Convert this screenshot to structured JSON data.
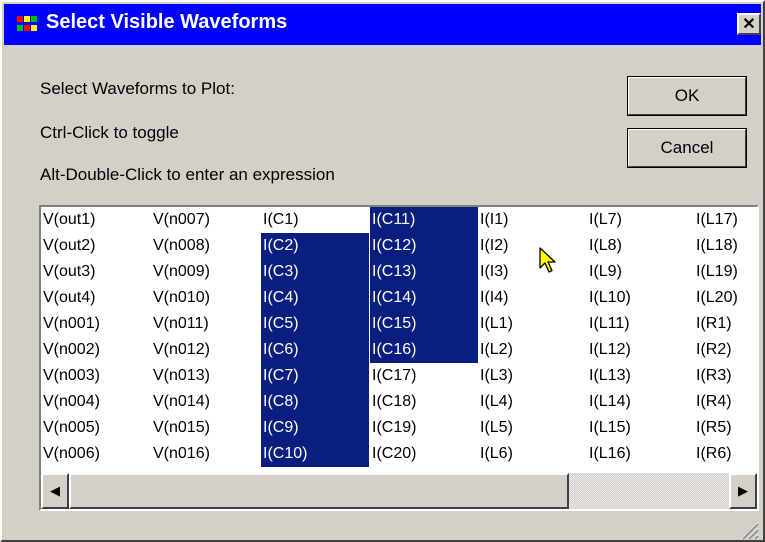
{
  "window": {
    "title": "Select Visible Waveforms",
    "close_label": "✕",
    "icon": "app-waveform-icon"
  },
  "instructions": {
    "line1": "Select Waveforms to Plot:",
    "line2": "Ctrl-Click to toggle",
    "line3": "Alt-Double-Click to enter an expression"
  },
  "buttons": {
    "ok": "OK",
    "cancel": "Cancel"
  },
  "colors": {
    "title_bar": "#0000ff",
    "selection": "#0a1e80",
    "face": "#d4d0c8"
  },
  "list": {
    "columns": [
      {
        "items": [
          {
            "label": "V(out1)",
            "selected": false
          },
          {
            "label": "V(out2)",
            "selected": false
          },
          {
            "label": "V(out3)",
            "selected": false
          },
          {
            "label": "V(out4)",
            "selected": false
          },
          {
            "label": "V(n001)",
            "selected": false
          },
          {
            "label": "V(n002)",
            "selected": false
          },
          {
            "label": "V(n003)",
            "selected": false
          },
          {
            "label": "V(n004)",
            "selected": false
          },
          {
            "label": "V(n005)",
            "selected": false
          },
          {
            "label": "V(n006)",
            "selected": false
          }
        ]
      },
      {
        "items": [
          {
            "label": "V(n007)",
            "selected": false
          },
          {
            "label": "V(n008)",
            "selected": false
          },
          {
            "label": "V(n009)",
            "selected": false
          },
          {
            "label": "V(n010)",
            "selected": false
          },
          {
            "label": "V(n011)",
            "selected": false
          },
          {
            "label": "V(n012)",
            "selected": false
          },
          {
            "label": "V(n013)",
            "selected": false
          },
          {
            "label": "V(n014)",
            "selected": false
          },
          {
            "label": "V(n015)",
            "selected": false
          },
          {
            "label": "V(n016)",
            "selected": false
          }
        ]
      },
      {
        "items": [
          {
            "label": "I(C1)",
            "selected": false
          },
          {
            "label": "I(C2)",
            "selected": true
          },
          {
            "label": "I(C3)",
            "selected": true
          },
          {
            "label": "I(C4)",
            "selected": true
          },
          {
            "label": "I(C5)",
            "selected": true
          },
          {
            "label": "I(C6)",
            "selected": true
          },
          {
            "label": "I(C7)",
            "selected": true
          },
          {
            "label": "I(C8)",
            "selected": true
          },
          {
            "label": "I(C9)",
            "selected": true
          },
          {
            "label": "I(C10)",
            "selected": true
          }
        ]
      },
      {
        "items": [
          {
            "label": "I(C11)",
            "selected": true
          },
          {
            "label": "I(C12)",
            "selected": true
          },
          {
            "label": "I(C13)",
            "selected": true
          },
          {
            "label": "I(C14)",
            "selected": true
          },
          {
            "label": "I(C15)",
            "selected": true
          },
          {
            "label": "I(C16)",
            "selected": true
          },
          {
            "label": "I(C17)",
            "selected": false
          },
          {
            "label": "I(C18)",
            "selected": false
          },
          {
            "label": "I(C19)",
            "selected": false
          },
          {
            "label": "I(C20)",
            "selected": false
          }
        ]
      },
      {
        "items": [
          {
            "label": "I(I1)",
            "selected": false
          },
          {
            "label": "I(I2)",
            "selected": false
          },
          {
            "label": "I(I3)",
            "selected": false
          },
          {
            "label": "I(I4)",
            "selected": false
          },
          {
            "label": "I(L1)",
            "selected": false
          },
          {
            "label": "I(L2)",
            "selected": false
          },
          {
            "label": "I(L3)",
            "selected": false
          },
          {
            "label": "I(L4)",
            "selected": false
          },
          {
            "label": "I(L5)",
            "selected": false
          },
          {
            "label": "I(L6)",
            "selected": false
          }
        ]
      },
      {
        "items": [
          {
            "label": "I(L7)",
            "selected": false
          },
          {
            "label": "I(L8)",
            "selected": false
          },
          {
            "label": "I(L9)",
            "selected": false
          },
          {
            "label": "I(L10)",
            "selected": false
          },
          {
            "label": "I(L11)",
            "selected": false
          },
          {
            "label": "I(L12)",
            "selected": false
          },
          {
            "label": "I(L13)",
            "selected": false
          },
          {
            "label": "I(L14)",
            "selected": false
          },
          {
            "label": "I(L15)",
            "selected": false
          },
          {
            "label": "I(L16)",
            "selected": false
          }
        ]
      },
      {
        "items": [
          {
            "label": "I(L17)",
            "selected": false
          },
          {
            "label": "I(L18)",
            "selected": false
          },
          {
            "label": "I(L19)",
            "selected": false
          },
          {
            "label": "I(L20)",
            "selected": false
          },
          {
            "label": "I(R1)",
            "selected": false
          },
          {
            "label": "I(R2)",
            "selected": false
          },
          {
            "label": "I(R3)",
            "selected": false
          },
          {
            "label": "I(R4)",
            "selected": false
          },
          {
            "label": "I(R5)",
            "selected": false
          },
          {
            "label": "I(R6)",
            "selected": false
          }
        ]
      }
    ]
  },
  "scrollbar": {
    "left_arrow": "◀",
    "right_arrow": "▶"
  }
}
